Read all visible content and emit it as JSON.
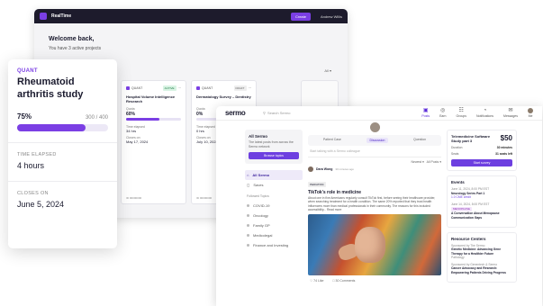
{
  "realtime": {
    "app_name": "RealTime",
    "create_label": "Create",
    "user_name": "Andrew Willis",
    "welcome": "Welcome back,",
    "subtitle": "You have 3 active projects",
    "filter": "All",
    "cards": [
      {
        "type": "QUANT",
        "status": "ACTIVE",
        "title": "Hospital Volume Intelligence Research",
        "quota_label": "Quota",
        "percent": "60%",
        "percent_value": 0.6,
        "elapsed_label": "Time elapsed",
        "elapsed": "34 hrs",
        "closes_label": "Closes on",
        "closes": "May 17, 2024",
        "footer": "ID 00000000"
      },
      {
        "type": "QUANT",
        "status": "DRAFT",
        "title": "Dermatology Survey – Dentistry",
        "quota_label": "Quota",
        "percent": "0%",
        "percent_value": 0.0,
        "elapsed_label": "Time elapsed",
        "elapsed": "0 hrs",
        "closes_label": "Closes on",
        "closes": "July 10, 2024",
        "footer": "ID 00000000"
      }
    ]
  },
  "sermo": {
    "logo": "sermo",
    "search_placeholder": "Search Sermo",
    "nav": [
      {
        "label": "Posts",
        "glyph": "▣",
        "active": true
      },
      {
        "label": "Earn",
        "glyph": "◎",
        "active": false
      },
      {
        "label": "Groups",
        "glyph": "☷",
        "active": false
      },
      {
        "label": "Notifications",
        "glyph": "◔",
        "active": false
      },
      {
        "label": "Messages",
        "glyph": "✉",
        "active": false
      },
      {
        "label": "Me",
        "glyph": "",
        "active": false
      }
    ],
    "cta": {
      "title": "All Sermo",
      "text": "The latest posts from across the Sermo network",
      "button": "Browse topics"
    },
    "menu": {
      "items": [
        "All Sermo",
        "Saves"
      ],
      "topics_title": "Followed Topics",
      "topics": [
        "COVID-19",
        "Oncology",
        "Family GP",
        "Medicolegal",
        "Finance and Investing"
      ]
    },
    "tabs": [
      "Patient Case",
      "Discussion",
      "Question"
    ],
    "compose_placeholder": "Start talking with a Sermo colleague",
    "sort": [
      "Newest",
      "All Posts"
    ],
    "post": {
      "author": "Dara Wong",
      "time": "30 minutes ago",
      "chip": "PEDIATRIC",
      "title": "TikTok's role in medicine",
      "body": "About one in five Americans regularly consult TikTok first, before seeing their healthcare provider, when searching treatment for a health condition. The same 20% reported that they trust health influencers more than medical professionals in their community. The reasons for this included accessibility... Read more",
      "likes": "74 Like",
      "comments": "30 Comments"
    },
    "survey": {
      "title": "Telemedicine Software Study part 3",
      "price": "$50",
      "duration_label": "Duration",
      "duration": "30 minutes",
      "seats_label": "Seats",
      "seats": "31 seats left",
      "button": "Start survey"
    },
    "events": {
      "title": "Events",
      "items": [
        {
          "date": "June 11, 2024, 8:00 PM EST",
          "name": "Neurology Series Part 1",
          "credit": "1.0 CME credit"
        },
        {
          "date": "June 14, 2024, 8:00 PM EST",
          "chip": "MENOPAUSE",
          "name": "A Conversation About Menopause Communication Gaps"
        }
      ]
    },
    "resources": {
      "title": "Resource Centers",
      "items": [
        {
          "sponsor": "Sponsored by The Sermo",
          "name": "Genetic Medicine: Advancing Gene Therapy for a Healthier Future",
          "meta": "Pathology"
        },
        {
          "sponsor": "Sponsored by Genentech & Sermo",
          "name": "Cancer Advocacy and Research: Empowering Patients Driving Progress",
          "meta": ""
        }
      ]
    }
  },
  "quant_card": {
    "type": "QUANT",
    "title": "Rheumatoid arthritis study",
    "percent": "75%",
    "count": "300 / 400",
    "progress": 0.75,
    "elapsed_label": "TIME ELAPSED",
    "elapsed": "4 hours",
    "closes_label": "CLOSES ON",
    "closes": "June 5, 2024"
  },
  "colors": {
    "accent": "#7b3fe4",
    "dark": "#1d1b2c"
  }
}
